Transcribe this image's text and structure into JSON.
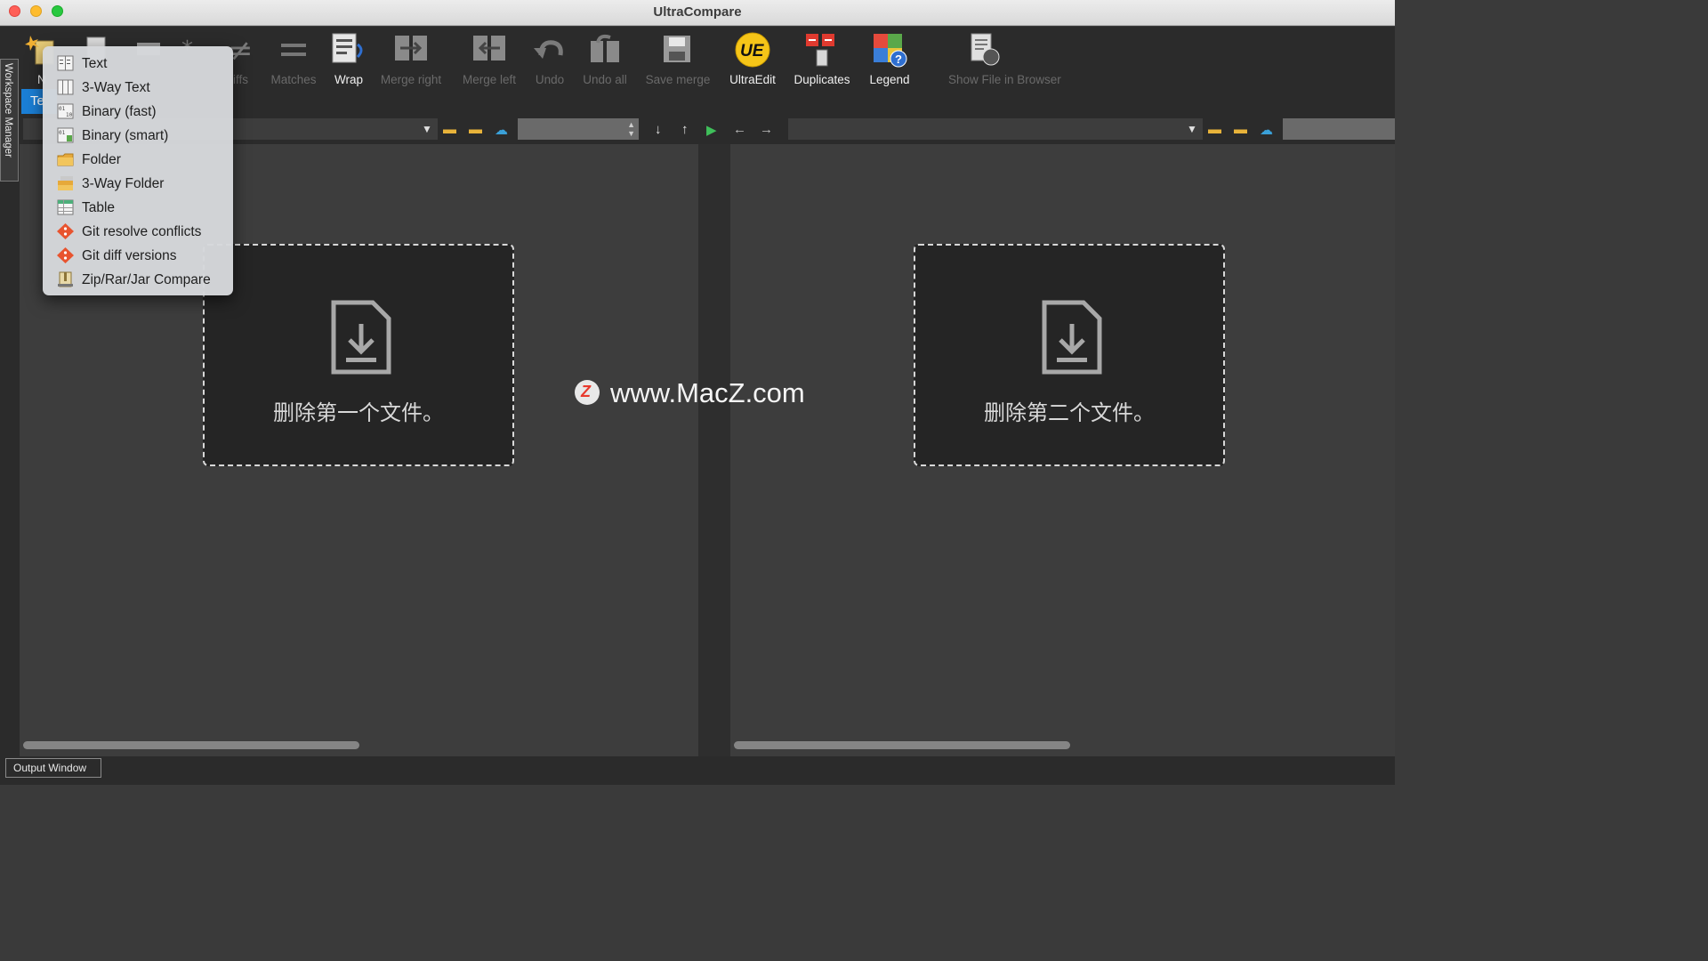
{
  "window": {
    "title": "UltraCompare"
  },
  "workspace_manager": {
    "label": "Workspace Manager"
  },
  "toolbar": {
    "new_label_partial": "N",
    "diffs_label_partial": "iffs",
    "matches_label": "Matches",
    "wrap_label": "Wrap",
    "merge_right_label": "Merge right",
    "merge_left_label": "Merge left",
    "undo_label": "Undo",
    "undo_all_label": "Undo all",
    "save_merge_label": "Save merge",
    "ultraedit_label": "UltraEdit",
    "ultraedit_logo_text": "UE",
    "duplicates_label": "Duplicates",
    "legend_label": "Legend",
    "show_file_label": "Show File in Browser"
  },
  "tabs": {
    "active_partial": "Te"
  },
  "new_menu": {
    "items": [
      {
        "label": "Text",
        "icon": "text-compare-icon"
      },
      {
        "label": "3-Way Text",
        "icon": "three-way-text-icon"
      },
      {
        "label": "Binary (fast)",
        "icon": "binary-icon"
      },
      {
        "label": "Binary (smart)",
        "icon": "binary-smart-icon"
      },
      {
        "label": "Folder",
        "icon": "folder-icon"
      },
      {
        "label": "3-Way Folder",
        "icon": "three-way-folder-icon"
      },
      {
        "label": "Table",
        "icon": "table-icon"
      },
      {
        "label": "Git resolve conflicts",
        "icon": "git-icon"
      },
      {
        "label": "Git diff versions",
        "icon": "git-icon"
      },
      {
        "label": "Zip/Rar/Jar Compare",
        "icon": "archive-icon"
      }
    ]
  },
  "left_pane": {
    "drop_text": "删除第一个文件。"
  },
  "right_pane": {
    "drop_text": "删除第二个文件。"
  },
  "watermark": {
    "logo_letter": "Z",
    "text": "www.MacZ.com"
  },
  "output_window": {
    "label": "Output Window"
  },
  "colors": {
    "accent": "#1b7fd6",
    "pane_bg": "#3d3d3d",
    "toolbar_bg": "#2b2b2b",
    "nav_green": "#3fbf5a"
  }
}
